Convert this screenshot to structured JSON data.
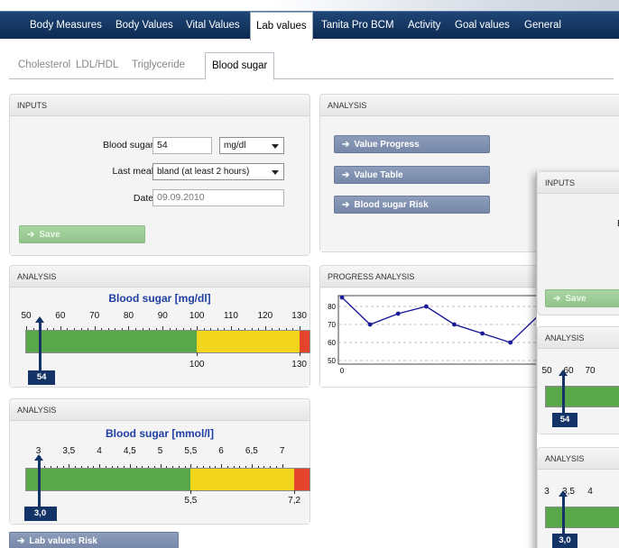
{
  "topnav": {
    "items": [
      "Body Measures",
      "Body Values",
      "Vital Values",
      "Lab values",
      "Tanita Pro BCM",
      "Activity",
      "Goal values",
      "General"
    ],
    "active": "Lab values"
  },
  "subtabs": {
    "items": [
      "Cholesterol",
      "LDL/HDL",
      "Triglyceride",
      "Blood sugar"
    ],
    "active": "Blood sugar"
  },
  "inputs_panel": {
    "title": "INPUTS",
    "blood_sugar_label": "Blood sugar:",
    "blood_sugar_value": "54",
    "unit_selected": "mg/dl",
    "last_meal_label": "Last meal:",
    "last_meal_selected": "bland (at least 2 hours)",
    "date_label": "Date:",
    "date_value": "09.09.2010",
    "save_label": "Save"
  },
  "analysis_panel": {
    "title": "ANALYSIS",
    "buttons": [
      "Value Progress",
      "Value Table",
      "Blood sugar Risk"
    ]
  },
  "gauge_mgdl": {
    "panel_title": "ANALYSIS",
    "title": "Blood sugar [mg/dl]",
    "ticks": [
      "50",
      "60",
      "70",
      "80",
      "90",
      "100",
      "110",
      "120",
      "130"
    ],
    "threshold_labels": [
      "100",
      "130"
    ],
    "pointer_value_label": "54",
    "range": [
      50,
      133
    ],
    "value": 54,
    "zones": [
      {
        "from": 50,
        "to": 100,
        "color": "#5aa64a"
      },
      {
        "from": 100,
        "to": 130,
        "color": "#f2d51d"
      },
      {
        "from": 130,
        "to": 133,
        "color": "#e4432c"
      }
    ]
  },
  "gauge_mmol": {
    "panel_title": "ANALYSIS",
    "title": "Blood sugar [mmol/l]",
    "ticks": [
      "3",
      "3,5",
      "4",
      "4,5",
      "5",
      "5,5",
      "6",
      "6,5",
      "7"
    ],
    "threshold_labels": [
      "5,5",
      "7,2"
    ],
    "pointer_value_label": "3,0",
    "range": [
      2.8,
      7.45
    ],
    "value": 3.0,
    "zones": [
      {
        "from": 2.8,
        "to": 5.5,
        "color": "#5aa64a"
      },
      {
        "from": 5.5,
        "to": 7.2,
        "color": "#f2d51d"
      },
      {
        "from": 7.2,
        "to": 7.45,
        "color": "#e4432c"
      }
    ]
  },
  "progress_panel": {
    "title": "PROGRESS ANALYSIS"
  },
  "chart_data": {
    "type": "line",
    "title": "",
    "xlabel": "",
    "ylabel": "",
    "x_tick_labels": [
      "0"
    ],
    "y_ticks": [
      50,
      60,
      70,
      80
    ],
    "ylim": [
      48,
      86
    ],
    "grid": true,
    "series": [
      {
        "values": [
          85,
          70,
          76,
          80,
          70,
          65,
          60,
          75,
          63,
          60
        ]
      }
    ]
  },
  "lab_risk_button": "Lab values Risk",
  "overlay": {
    "inputs_title": "INPUTS",
    "save_label": "Save",
    "analysis_title_1": "ANALYSIS",
    "ticks_1": [
      "50",
      "60",
      "70"
    ],
    "badge_1": "54",
    "analysis_title_2": "ANALYSIS",
    "ticks_2": [
      "3",
      "3,5",
      "4"
    ],
    "badge_2": "3,0",
    "cut_letter": "B"
  }
}
